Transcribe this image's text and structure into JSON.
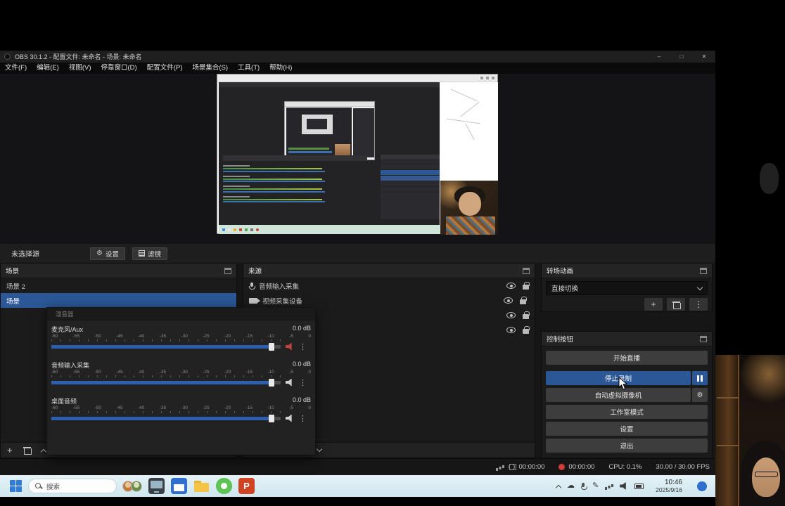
{
  "colors": {
    "accent_blue": "#2b5797",
    "record_red": "#d23b3b",
    "taskbar_bg": "#d8ecf2",
    "dock_bg": "#1b1b1b",
    "dock_header_bg": "#242424",
    "meter_blue": "#2d5fae"
  },
  "icons": {
    "gear": "⚙",
    "plus": "+",
    "dots": "⋮",
    "cloud": "☁",
    "pen": "✎"
  },
  "window": {
    "title": "OBS 30.1.2 - 配置文件: 未命名 - 场景: 未命名",
    "menus": [
      "文件(F)",
      "编辑(E)",
      "视图(V)",
      "停靠窗口(D)",
      "配置文件(P)",
      "场景集合(S)",
      "工具(T)",
      "帮助(H)"
    ],
    "controls": {
      "minimize": "–",
      "maximize": "□",
      "close": "✕"
    }
  },
  "source_toolbar": {
    "no_source": "未选择源",
    "settings": "设置",
    "filters": "滤镜"
  },
  "scenes": {
    "title": "场景",
    "items": [
      {
        "label": "场景 2",
        "selected": false
      },
      {
        "label": "场景",
        "selected": true
      }
    ]
  },
  "sources": {
    "title": "来源",
    "items": [
      {
        "label": "音频输入采集",
        "icon": "mic"
      },
      {
        "label": "视频采集设备",
        "icon": "camera"
      },
      {
        "label": "",
        "icon": ""
      },
      {
        "label": "",
        "icon": ""
      }
    ]
  },
  "mixer": {
    "title": "混音器",
    "scale": [
      "-60",
      "-55",
      "-50",
      "-45",
      "-40",
      "-35",
      "-30",
      "-25",
      "-20",
      "-15",
      "-10",
      "-5",
      "0"
    ],
    "channels": [
      {
        "name": "麦克风/Aux",
        "db": "0.0 dB",
        "muted": true
      },
      {
        "name": "音频输入采集",
        "db": "0.0 dB",
        "muted": false
      },
      {
        "name": "桌面音频",
        "db": "0.0 dB",
        "muted": false
      }
    ]
  },
  "transitions": {
    "title": "转场动画",
    "current": "直接切换"
  },
  "controls_dock": {
    "title": "控制按钮",
    "start_stream": "开始直播",
    "stop_record": "停止录制",
    "virtual_cam": "自动虚拟摄像机",
    "studio_mode": "工作室模式",
    "settings": "设置",
    "exit": "退出"
  },
  "statusbar": {
    "stream_time": "00:00:00",
    "rec_time": "00:00:00",
    "cpu": "CPU: 0.1%",
    "fps": "30.00 / 30.00 FPS"
  },
  "taskbar": {
    "search": "搜索",
    "time": "10:46",
    "date": "2025/9/16"
  }
}
